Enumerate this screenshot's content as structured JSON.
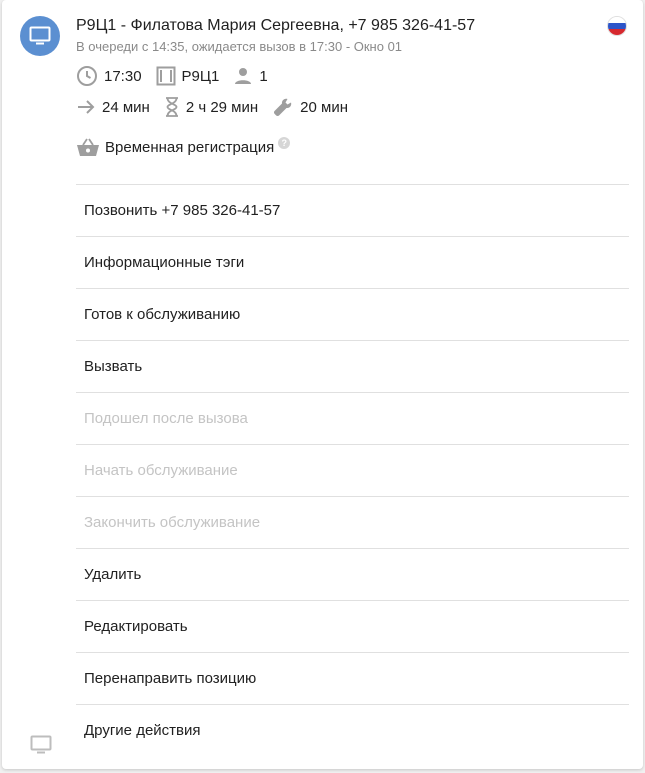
{
  "header": {
    "title": "Р9Ц1 - Филатова Мария Сергеевна, +7 985 326-41-57",
    "subtitle": "В очереди с 14:35, ожидается вызов в 17:30 - Окно 01",
    "avatar_icon": "monitor-icon",
    "flag_icon": "russia-flag-icon",
    "avatar_color": "#5b8fd1"
  },
  "meta": {
    "time": "17:30",
    "ticket": "Р9Ц1",
    "persons": "1",
    "wait": "24 мин",
    "remaining": "2 ч 29 мин",
    "service": "20 мин"
  },
  "registration": {
    "label": "Временная регистрация",
    "help": "?"
  },
  "menu": {
    "items": [
      {
        "label": "Позвонить +7 985 326-41-57",
        "enabled": true
      },
      {
        "label": "Информационные тэги",
        "enabled": true
      },
      {
        "label": "Готов к обслуживанию",
        "enabled": true
      },
      {
        "label": "Вызвать",
        "enabled": true
      },
      {
        "label": "Подошел после вызова",
        "enabled": false
      },
      {
        "label": "Начать обслуживание",
        "enabled": false
      },
      {
        "label": "Закончить обслуживание",
        "enabled": false
      },
      {
        "label": "Удалить",
        "enabled": true
      },
      {
        "label": "Редактировать",
        "enabled": true
      },
      {
        "label": "Перенаправить позицию",
        "enabled": true
      },
      {
        "label": "Другие действия",
        "enabled": true
      }
    ]
  },
  "footer": {
    "icon": "monitor-icon"
  }
}
